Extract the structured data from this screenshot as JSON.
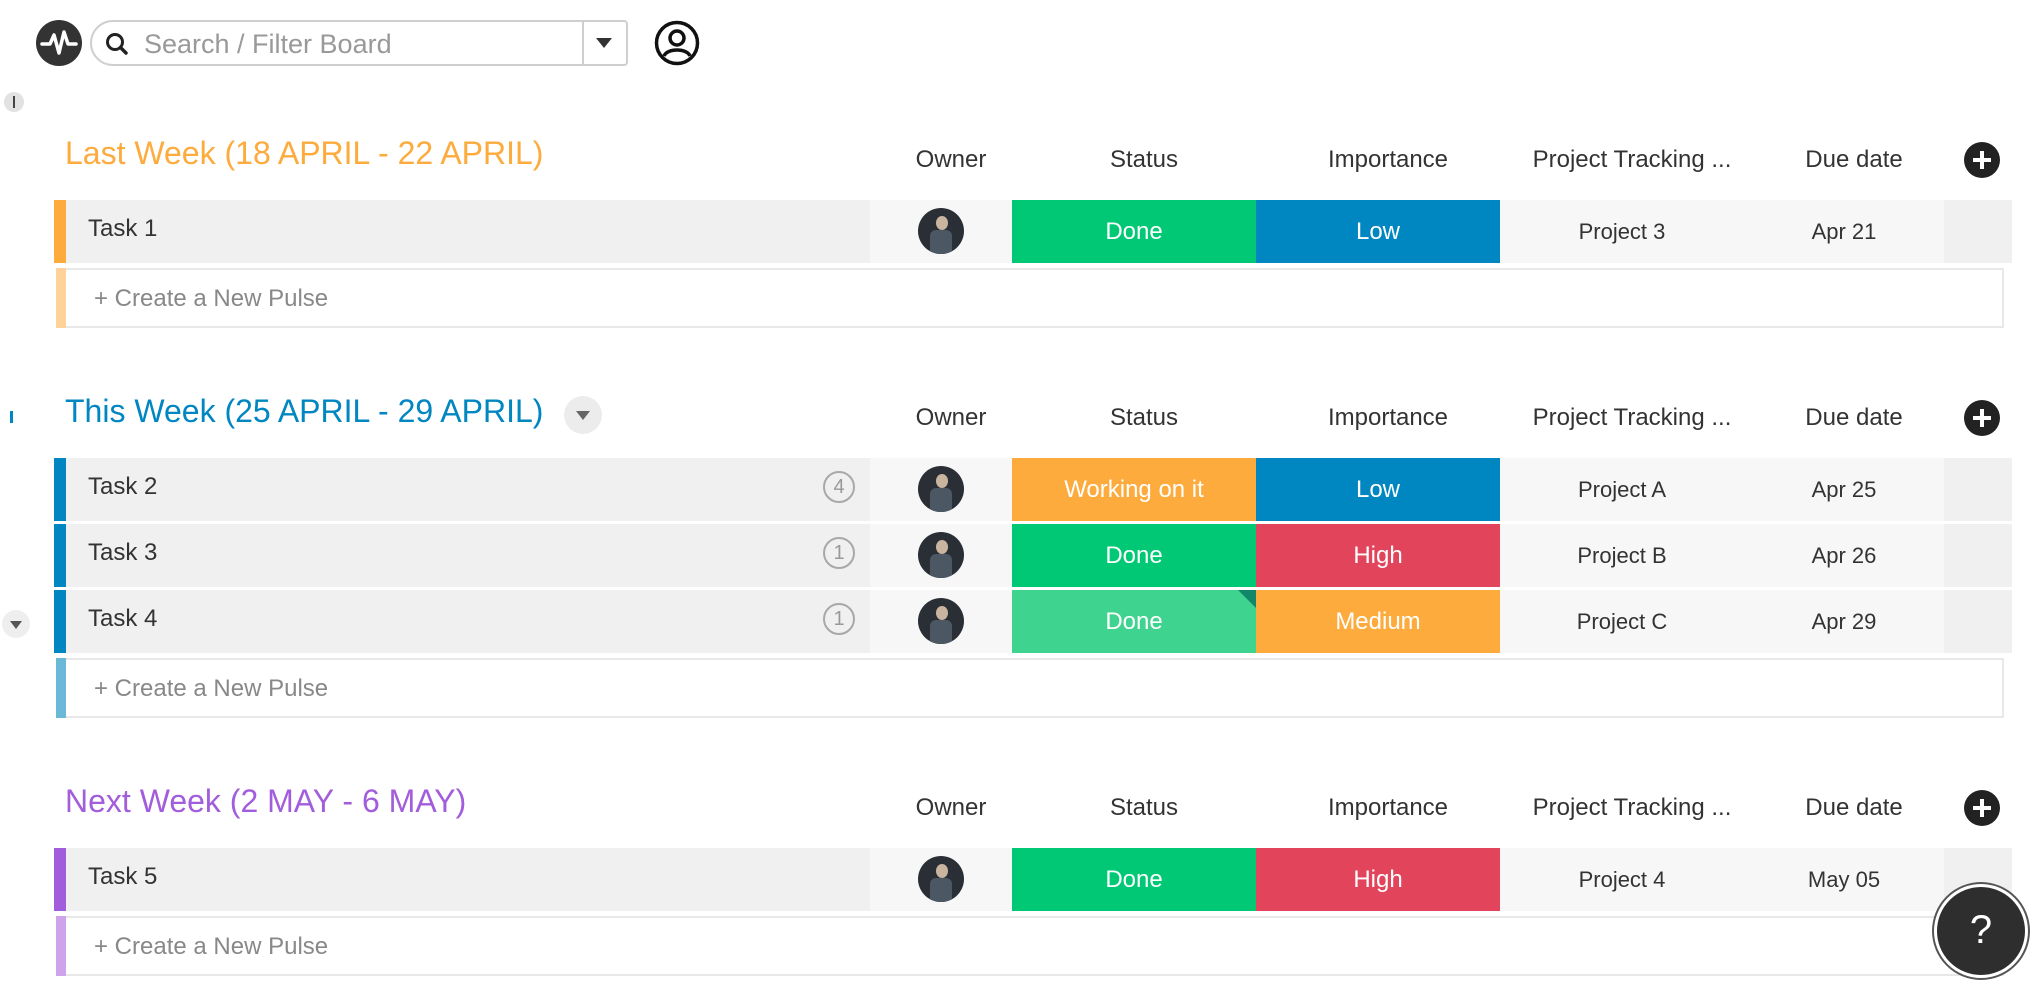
{
  "search": {
    "placeholder": "Search / Filter Board"
  },
  "colors": {
    "done": "#00c875",
    "done_light": "#3ed38f",
    "working": "#fdab3d",
    "low": "#0086c0",
    "high": "#e2445c",
    "medium": "#fdab3d"
  },
  "columns": {
    "owner": "Owner",
    "status": "Status",
    "importance": "Importance",
    "project": "Project Tracking ...",
    "due": "Due date"
  },
  "new_pulse_label": "+ Create a New Pulse",
  "groups": [
    {
      "title": "Last Week (18 APRIL - 22 APRIL)",
      "color": "#fdab3d",
      "light": "#ffd29a",
      "rows": [
        {
          "name": "Task 1",
          "badge": "",
          "status": "Done",
          "importance": "Low",
          "project": "Project 3",
          "due": "Apr 21"
        }
      ]
    },
    {
      "title": "This Week (25 APRIL - 29 APRIL)",
      "color": "#0086c0",
      "light": "#6cb8d8",
      "rows": [
        {
          "name": "Task 2",
          "badge": "4",
          "status": "Working on it",
          "importance": "Low",
          "project": "Project A",
          "due": "Apr 25"
        },
        {
          "name": "Task 3",
          "badge": "1",
          "status": "Done",
          "importance": "High",
          "project": "Project B",
          "due": "Apr 26"
        },
        {
          "name": "Task 4",
          "badge": "1",
          "status": "Done",
          "importance": "Medium",
          "project": "Project C",
          "due": "Apr 29"
        }
      ]
    },
    {
      "title": "Next Week (2 MAY - 6 MAY)",
      "color": "#a25ddc",
      "light": "#cfa3ea",
      "rows": [
        {
          "name": "Task 5",
          "badge": "",
          "status": "Done",
          "importance": "High",
          "project": "Project 4",
          "due": "May 05"
        }
      ]
    }
  ],
  "help": {
    "label": "?"
  }
}
